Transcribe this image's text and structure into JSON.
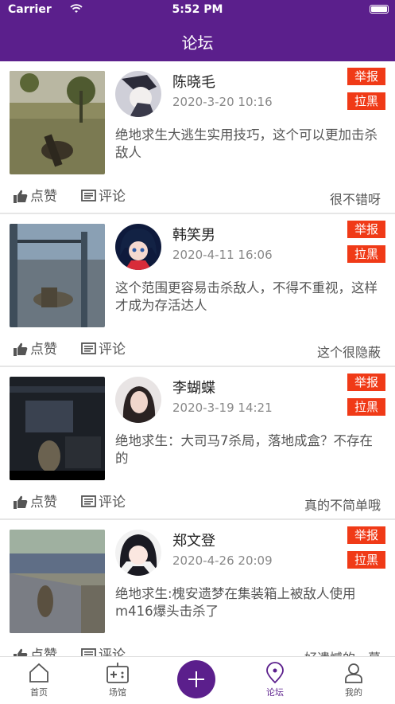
{
  "status_bar": {
    "carrier": "Carrier",
    "time": "5:52 PM"
  },
  "nav": {
    "title": "论坛"
  },
  "labels": {
    "report": "举报",
    "block": "拉黑",
    "like": "点赞",
    "comment": "评论"
  },
  "posts": [
    {
      "name": "陈晓毛",
      "date": "2020-3-20 10:16",
      "content": "绝地求生大逃生实用技巧，这个可以更加击杀敌人",
      "remark": "很不错呀"
    },
    {
      "name": "韩笑男",
      "date": "2020-4-11 16:06",
      "content": "这个范围更容易击杀敌人，不得不重视，这样才成为存活达人",
      "remark": "这个很隐蔽"
    },
    {
      "name": "李蝴蝶",
      "date": "2020-3-19 14:21",
      "content": "绝地求生：大司马7杀局，落地成盒？不存在的",
      "remark": "真的不简单哦"
    },
    {
      "name": "郑文登",
      "date": "2020-4-26 20:09",
      "content": "绝地求生:槐安遗梦在集装箱上被敌人使用m416爆头击杀了",
      "remark": "好遗憾的一幕"
    }
  ],
  "tabs": [
    {
      "label": "首页",
      "icon": "home-icon"
    },
    {
      "label": "场馆",
      "icon": "gamepad-icon"
    },
    {
      "label": "",
      "icon": "plus-icon"
    },
    {
      "label": "论坛",
      "icon": "location-pin-icon"
    },
    {
      "label": "我的",
      "icon": "person-icon"
    }
  ],
  "colors": {
    "brand": "#5b1f8c",
    "tag": "#f03a17"
  }
}
